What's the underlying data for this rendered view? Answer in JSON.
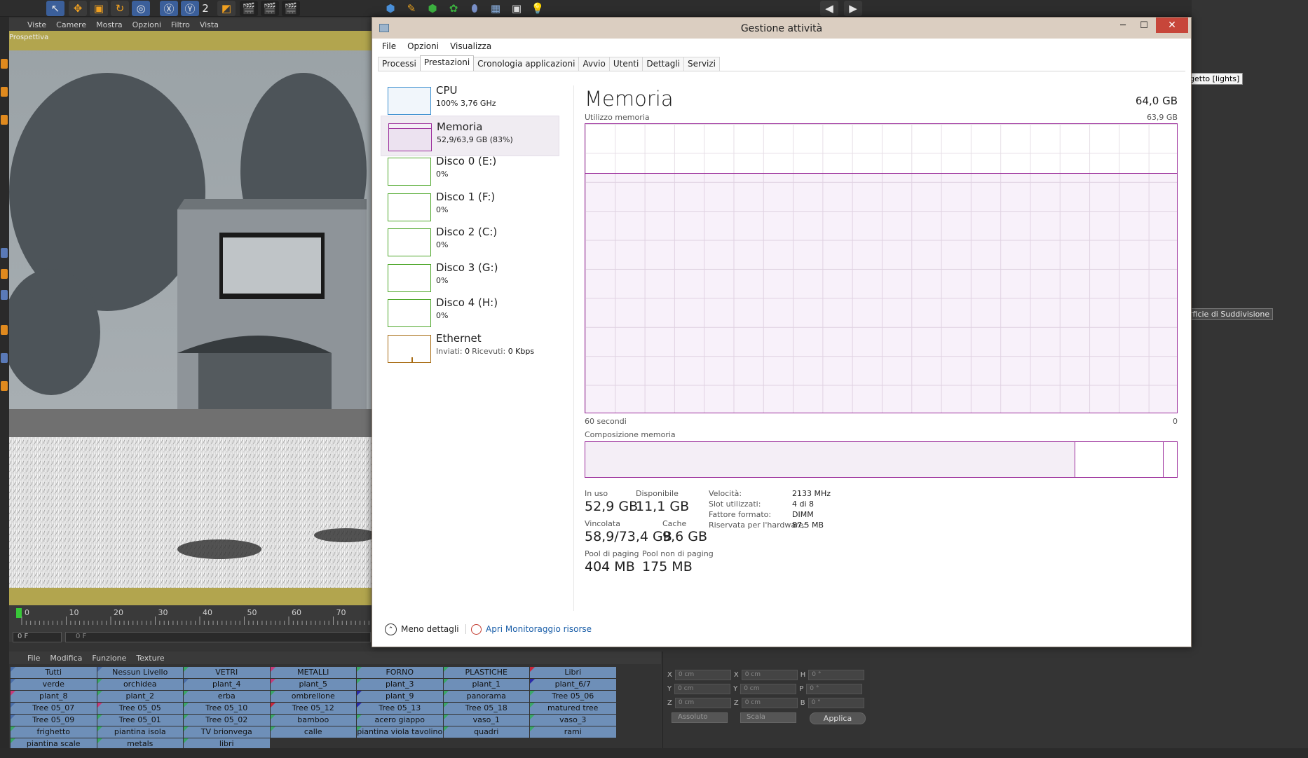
{
  "c4d": {
    "topbar_num": "2",
    "viewport_menu": [
      "Viste",
      "Camere",
      "Mostra",
      "Opzioni",
      "Filtro",
      "Vista"
    ],
    "viewport_label": "Prospettiva",
    "timeline_ticks": [
      "0",
      "10",
      "20",
      "30",
      "40",
      "50",
      "60",
      "70",
      "8"
    ],
    "frame_current": "0 F",
    "frame_range": "0 F",
    "mat_menu": [
      "File",
      "Modifica",
      "Funzione",
      "Texture"
    ],
    "layers": [
      {
        "name": "Tutti",
        "color": "#4a6ea8"
      },
      {
        "name": "Nessun Livello",
        "color": "#4a6ea8"
      },
      {
        "name": "VETRI",
        "color": "#3aa868"
      },
      {
        "name": "METALLI",
        "color": "#c83a7a"
      },
      {
        "name": "FORNO",
        "color": "#3aa868"
      },
      {
        "name": "PLASTICHE",
        "color": "#3aa868"
      },
      {
        "name": "Libri",
        "color": "#c8263a"
      },
      {
        "name": "verde",
        "color": "#4a6ea8"
      },
      {
        "name": "orchidea",
        "color": "#3aa868"
      },
      {
        "name": "plant_4",
        "color": "#4a6ea8"
      },
      {
        "name": "plant_5",
        "color": "#c83a7a"
      },
      {
        "name": "plant_3",
        "color": "#3aa868"
      },
      {
        "name": "plant_1",
        "color": "#3aa868"
      },
      {
        "name": "plant_6/7",
        "color": "#2a2aa8"
      },
      {
        "name": "plant_8",
        "color": "#c83a7a"
      },
      {
        "name": "plant_2",
        "color": "#3aa868"
      },
      {
        "name": "erba",
        "color": "#3aa868"
      },
      {
        "name": "ombrellone",
        "color": "#3aa868"
      },
      {
        "name": "plant_9",
        "color": "#2a2aa8"
      },
      {
        "name": "panorama",
        "color": "#3aa868"
      },
      {
        "name": "Tree 05_06",
        "color": "#3aa868"
      },
      {
        "name": "Tree 05_07",
        "color": "#4a6ea8"
      },
      {
        "name": "Tree 05_05",
        "color": "#c83a7a"
      },
      {
        "name": "Tree 05_10",
        "color": "#3aa868"
      },
      {
        "name": "Tree 05_12",
        "color": "#c8263a"
      },
      {
        "name": "Tree 05_13",
        "color": "#2a2aa8"
      },
      {
        "name": "Tree 05_18",
        "color": "#3aa868"
      },
      {
        "name": "matured tree",
        "color": "#3aa868"
      },
      {
        "name": "Tree 05_09",
        "color": "#4a6ea8"
      },
      {
        "name": "Tree 05_01",
        "color": "#3aa868"
      },
      {
        "name": "Tree 05_02",
        "color": "#3aa868"
      },
      {
        "name": "bamboo",
        "color": "#3aa868"
      },
      {
        "name": "acero giappo",
        "color": "#3aa868"
      },
      {
        "name": "vaso_1",
        "color": "#3aa868"
      },
      {
        "name": "vaso_3",
        "color": "#3aa868"
      },
      {
        "name": "frighetto",
        "color": "#3aa868"
      },
      {
        "name": "piantina isola",
        "color": "#3aa868"
      },
      {
        "name": "TV brionvega",
        "color": "#3aa868"
      },
      {
        "name": "calle",
        "color": "#3aa868"
      },
      {
        "name": "piantina viola tavolino",
        "color": "#3aa868"
      },
      {
        "name": "quadri",
        "color": "#3aa868"
      },
      {
        "name": "rami",
        "color": "#3aa868"
      },
      {
        "name": "piantina scale",
        "color": "#3aa868"
      },
      {
        "name": "metals",
        "color": "#3aa868"
      },
      {
        "name": "libri",
        "color": "#3aa868"
      }
    ],
    "coords": [
      {
        "a": "X",
        "av": "0 cm",
        "b": "X",
        "bv": "0 cm",
        "c": "H",
        "cv": "0 °"
      },
      {
        "a": "Y",
        "av": "0 cm",
        "b": "Y",
        "bv": "0 cm",
        "c": "P",
        "cv": "0 °"
      },
      {
        "a": "Z",
        "av": "0 cm",
        "b": "Z",
        "bv": "0 cm",
        "c": "B",
        "cv": "0 °"
      }
    ],
    "coord_dropdown1": "Assoluto",
    "coord_dropdown2": "Scala",
    "apply_label": "Applica",
    "tooltip1": "getto [lights]",
    "tooltip2": "rficie di Suddivisione"
  },
  "tm": {
    "title": "Gestione attività",
    "menu": [
      "File",
      "Opzioni",
      "Visualizza"
    ],
    "tabs": [
      "Processi",
      "Prestazioni",
      "Cronologia applicazioni",
      "Avvio",
      "Utenti",
      "Dettagli",
      "Servizi"
    ],
    "active_tab": 1,
    "side": [
      {
        "title": "CPU",
        "sub": "100% 3,76 GHz",
        "border": "#3b8fd0",
        "bg": "#f1f6fb"
      },
      {
        "title": "Memoria",
        "sub": "52,9/63,9 GB (83%)",
        "border": "#9b2d9b",
        "bg": "#f4eef6"
      },
      {
        "title": "Disco 0 (E:)",
        "sub": "0%",
        "border": "#4ea72a",
        "bg": "#fff"
      },
      {
        "title": "Disco 1 (F:)",
        "sub": "0%",
        "border": "#4ea72a",
        "bg": "#fff"
      },
      {
        "title": "Disco 2 (C:)",
        "sub": "0%",
        "border": "#4ea72a",
        "bg": "#fff"
      },
      {
        "title": "Disco 3 (G:)",
        "sub": "0%",
        "border": "#4ea72a",
        "bg": "#fff"
      },
      {
        "title": "Disco 4 (H:)",
        "sub": "0%",
        "border": "#4ea72a",
        "bg": "#fff"
      },
      {
        "title": "Ethernet",
        "sub_parts": [
          "Inviati: ",
          "0",
          "Ricevuti: ",
          "0 Kbps"
        ],
        "border": "#a86c14",
        "bg": "#fff"
      }
    ],
    "main": {
      "title": "Memoria",
      "total": "64,0 GB",
      "graph_label": "Utilizzo memoria",
      "graph_max": "63,9 GB",
      "usage_fraction": 0.83,
      "time_left": "60 secondi",
      "time_right": "0",
      "comp_label": "Composizione memoria",
      "comp_inuse_fraction": 0.828,
      "comp_cache_fraction": 0.15,
      "stats": {
        "in_use_label": "In uso",
        "in_use": "52,9 GB",
        "avail_label": "Disponibile",
        "avail": "11,1 GB",
        "committed_label": "Vincolata",
        "committed": "58,9/73,4 GB",
        "cache_label": "Cache",
        "cache": "9,6 GB",
        "paged_label": "Pool di paging",
        "paged": "404 MB",
        "nonpaged_label": "Pool non di paging",
        "nonpaged": "175 MB"
      },
      "specs": [
        {
          "label": "Velocità:",
          "value": "2133 MHz"
        },
        {
          "label": "Slot utilizzati:",
          "value": "4 di 8"
        },
        {
          "label": "Fattore formato:",
          "value": "DIMM"
        },
        {
          "label": "Riservata per l'hardware:",
          "value": "87,5 MB"
        }
      ]
    },
    "footer": {
      "fewer": "Meno dettagli",
      "monitor": "Apri Monitoraggio risorse"
    }
  }
}
